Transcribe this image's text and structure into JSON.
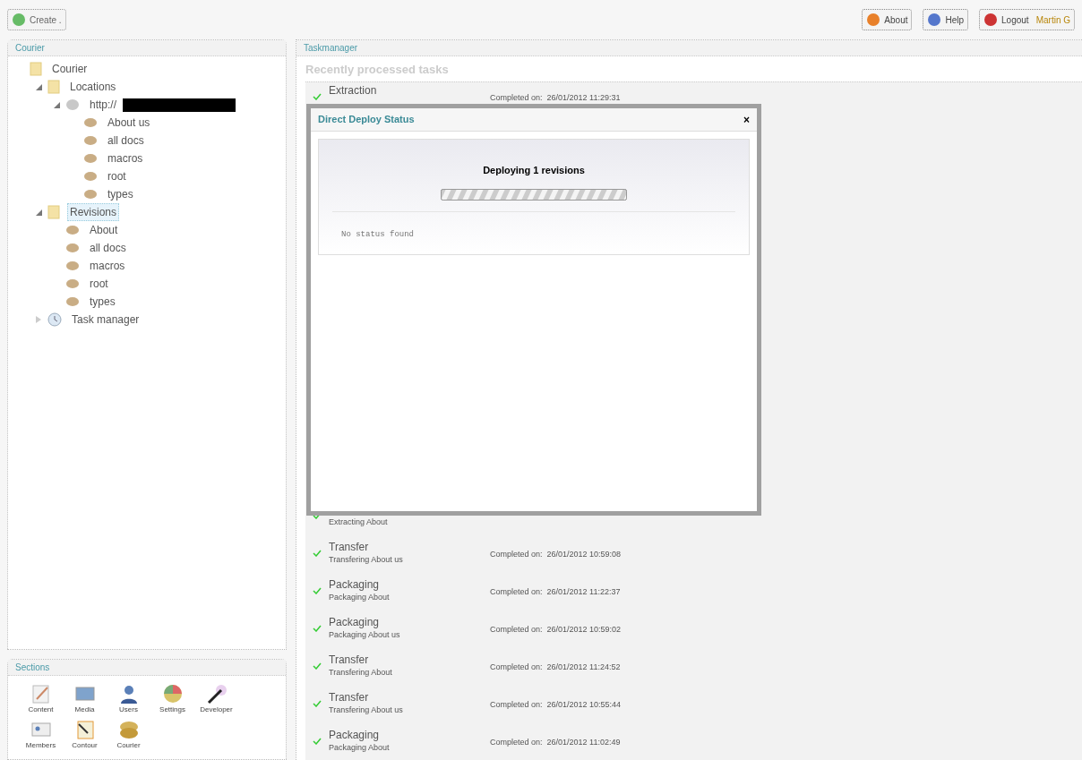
{
  "toolbar": {
    "create": "Create .",
    "about": "About",
    "help": "Help",
    "logout": "Logout",
    "user": "Martin G"
  },
  "tree_panel": {
    "title": "Courier",
    "tree": [
      {
        "label": "Courier",
        "kind": "folder",
        "children": [
          {
            "label": "Locations",
            "kind": "folder",
            "expanded": true,
            "selected": false,
            "children": [
              {
                "label": "http://",
                "kind": "server",
                "expanded": true,
                "selected": false,
                "redacted": true,
                "children": [
                  {
                    "label": "About us",
                    "kind": "document",
                    "selected": false
                  },
                  {
                    "label": "all docs",
                    "kind": "document",
                    "selected": false
                  },
                  {
                    "label": "macros",
                    "kind": "document",
                    "selected": false
                  },
                  {
                    "label": "root",
                    "kind": "document",
                    "selected": false
                  },
                  {
                    "label": "types",
                    "kind": "document",
                    "selected": false
                  }
                ]
              }
            ]
          },
          {
            "label": "Revisions",
            "kind": "folder",
            "expanded": true,
            "selected": true,
            "children": [
              {
                "label": "About",
                "kind": "document",
                "selected": false
              },
              {
                "label": "all docs",
                "kind": "document",
                "selected": false
              },
              {
                "label": "macros",
                "kind": "document",
                "selected": false
              },
              {
                "label": "root",
                "kind": "document",
                "selected": false
              },
              {
                "label": "types",
                "kind": "document",
                "selected": false
              }
            ]
          },
          {
            "label": "Task manager",
            "kind": "tasks",
            "expanded": false,
            "selected": false
          }
        ]
      }
    ]
  },
  "sections": {
    "title": "Sections",
    "items": [
      {
        "label": "Content",
        "kind": "content"
      },
      {
        "label": "Media",
        "kind": "media"
      },
      {
        "label": "Users",
        "kind": "users"
      },
      {
        "label": "Settings",
        "kind": "settings"
      },
      {
        "label": "Developer",
        "kind": "developer"
      },
      {
        "label": "Members",
        "kind": "members"
      },
      {
        "label": "Contour",
        "kind": "contour"
      },
      {
        "label": "Courier",
        "kind": "courier"
      }
    ]
  },
  "main": {
    "title": "Taskmanager",
    "heading": "Recently processed tasks",
    "tasks": [
      {
        "title": "Extraction",
        "completed": "Completed on:  26/01/2012 11:29:31"
      },
      {
        "subtitle": "Extracting About"
      },
      {
        "title": "Transfer",
        "subtitle": "Transfering About us",
        "completed": "Completed on:  26/01/2012 10:59:08"
      },
      {
        "title": "Packaging",
        "subtitle": "Packaging About",
        "completed": "Completed on:  26/01/2012 11:22:37"
      },
      {
        "title": "Packaging",
        "subtitle": "Packaging About us",
        "completed": "Completed on:  26/01/2012 10:59:02"
      },
      {
        "title": "Transfer",
        "subtitle": "Transfering About",
        "completed": "Completed on:  26/01/2012 11:24:52"
      },
      {
        "title": "Transfer",
        "subtitle": "Transfering About us",
        "completed": "Completed on:  26/01/2012 10:55:44"
      },
      {
        "title": "Packaging",
        "subtitle": "Packaging About",
        "completed": "Completed on:  26/01/2012 11:02:49"
      }
    ]
  },
  "dialog": {
    "title": "Direct Deploy Status",
    "close": "×",
    "message": "Deploying 1 revisions",
    "progress": {
      "level": 1
    },
    "status": "No status found"
  }
}
